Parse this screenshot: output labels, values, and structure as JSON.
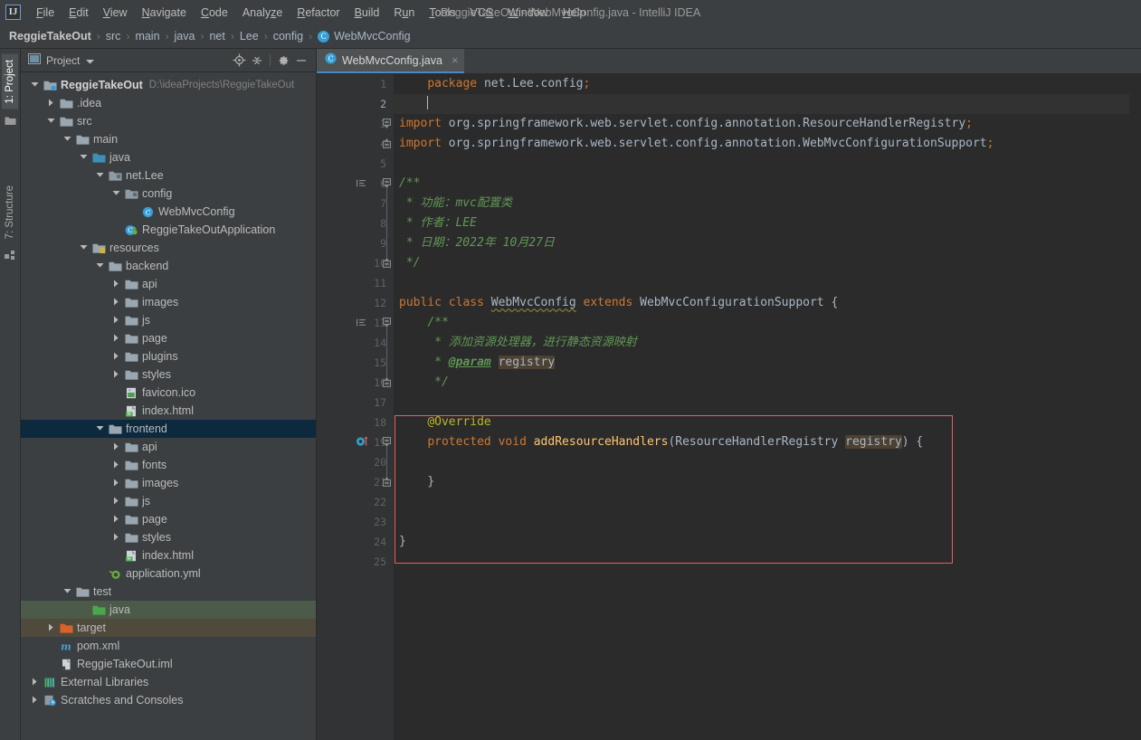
{
  "window": {
    "title": "ReggieTakeOut - WebMvcConfig.java - IntelliJ IDEA",
    "logo": "IJ"
  },
  "menubar": {
    "items": [
      {
        "label": "File",
        "mnemonic": "F"
      },
      {
        "label": "Edit",
        "mnemonic": "E"
      },
      {
        "label": "View",
        "mnemonic": "V"
      },
      {
        "label": "Navigate",
        "mnemonic": "N"
      },
      {
        "label": "Code",
        "mnemonic": "C"
      },
      {
        "label": "Analyze",
        "mnemonic": "z"
      },
      {
        "label": "Refactor",
        "mnemonic": "R"
      },
      {
        "label": "Build",
        "mnemonic": "B"
      },
      {
        "label": "Run",
        "mnemonic": "u"
      },
      {
        "label": "Tools",
        "mnemonic": "T"
      },
      {
        "label": "VCS",
        "mnemonic": "S"
      },
      {
        "label": "Window",
        "mnemonic": "W"
      },
      {
        "label": "Help",
        "mnemonic": "H"
      }
    ]
  },
  "breadcrumb": {
    "items": [
      "ReggieTakeOut",
      "src",
      "main",
      "java",
      "net",
      "Lee",
      "config"
    ],
    "leaf": "WebMvcConfig",
    "leaf_icon": "class-icon"
  },
  "toolstrip": {
    "tabs": [
      {
        "label": "1: Project",
        "active": true
      },
      {
        "label": "7: Structure",
        "active": false
      }
    ]
  },
  "project_panel": {
    "title": "Project",
    "buttons": [
      "locate-icon",
      "collapse-all-icon",
      "settings-icon",
      "hide-icon"
    ],
    "tree": [
      {
        "indent": 0,
        "twisty": "down",
        "icon": "module-folder",
        "label": "ReggieTakeOut",
        "bold": true,
        "path": "D:\\ideaProjects\\ReggieTakeOut"
      },
      {
        "indent": 1,
        "twisty": "right",
        "icon": "folder",
        "label": ".idea"
      },
      {
        "indent": 1,
        "twisty": "down",
        "icon": "folder",
        "label": "src"
      },
      {
        "indent": 2,
        "twisty": "down",
        "icon": "folder",
        "label": "main"
      },
      {
        "indent": 3,
        "twisty": "down",
        "icon": "source-folder",
        "label": "java"
      },
      {
        "indent": 4,
        "twisty": "down",
        "icon": "package",
        "label": "net.Lee"
      },
      {
        "indent": 5,
        "twisty": "down",
        "icon": "package",
        "label": "config"
      },
      {
        "indent": 6,
        "twisty": "none",
        "icon": "class-icon",
        "label": "WebMvcConfig"
      },
      {
        "indent": 5,
        "twisty": "none",
        "icon": "spring-class",
        "label": "ReggieTakeOutApplication"
      },
      {
        "indent": 3,
        "twisty": "down",
        "icon": "resource-folder",
        "label": "resources"
      },
      {
        "indent": 4,
        "twisty": "down",
        "icon": "folder",
        "label": "backend"
      },
      {
        "indent": 5,
        "twisty": "right",
        "icon": "folder",
        "label": "api"
      },
      {
        "indent": 5,
        "twisty": "right",
        "icon": "folder",
        "label": "images"
      },
      {
        "indent": 5,
        "twisty": "right",
        "icon": "folder",
        "label": "js"
      },
      {
        "indent": 5,
        "twisty": "right",
        "icon": "folder",
        "label": "page"
      },
      {
        "indent": 5,
        "twisty": "right",
        "icon": "folder",
        "label": "plugins"
      },
      {
        "indent": 5,
        "twisty": "right",
        "icon": "folder",
        "label": "styles"
      },
      {
        "indent": 5,
        "twisty": "none",
        "icon": "image-file",
        "label": "favicon.ico"
      },
      {
        "indent": 5,
        "twisty": "none",
        "icon": "html-file",
        "label": "index.html"
      },
      {
        "indent": 4,
        "twisty": "down",
        "icon": "folder",
        "label": "frontend",
        "selected": "blue"
      },
      {
        "indent": 5,
        "twisty": "right",
        "icon": "folder",
        "label": "api"
      },
      {
        "indent": 5,
        "twisty": "right",
        "icon": "folder",
        "label": "fonts"
      },
      {
        "indent": 5,
        "twisty": "right",
        "icon": "folder",
        "label": "images"
      },
      {
        "indent": 5,
        "twisty": "right",
        "icon": "folder",
        "label": "js"
      },
      {
        "indent": 5,
        "twisty": "right",
        "icon": "folder",
        "label": "page"
      },
      {
        "indent": 5,
        "twisty": "right",
        "icon": "folder",
        "label": "styles"
      },
      {
        "indent": 5,
        "twisty": "none",
        "icon": "html-file",
        "label": "index.html"
      },
      {
        "indent": 4,
        "twisty": "none",
        "icon": "yml-file",
        "label": "application.yml"
      },
      {
        "indent": 2,
        "twisty": "down",
        "icon": "folder",
        "label": "test"
      },
      {
        "indent": 3,
        "twisty": "none",
        "icon": "test-folder",
        "label": "java",
        "selected": "green"
      },
      {
        "indent": 1,
        "twisty": "right",
        "icon": "excluded-folder",
        "label": "target",
        "selected": "brown"
      },
      {
        "indent": 1,
        "twisty": "none",
        "icon": "maven-file",
        "label": "pom.xml"
      },
      {
        "indent": 1,
        "twisty": "none",
        "icon": "iml-file",
        "label": "ReggieTakeOut.iml"
      },
      {
        "indent": 0,
        "twisty": "right",
        "icon": "libraries-icon",
        "label": "External Libraries"
      },
      {
        "indent": 0,
        "twisty": "right",
        "icon": "scratches-icon",
        "label": "Scratches and Consoles"
      }
    ]
  },
  "editor": {
    "tab": {
      "label": "WebMvcConfig.java",
      "icon": "class-icon",
      "close": "×"
    },
    "current_line": 2,
    "total_lines": 25,
    "highlight_box": {
      "color": "#f05b5b",
      "from_line": 18,
      "to_line": 24
    },
    "gutter_markers": [
      {
        "line": 19,
        "icon": "override-method-icon"
      },
      {
        "line": 6,
        "icon": "doc-comment-icon"
      },
      {
        "line": 13,
        "icon": "doc-comment-icon"
      }
    ],
    "lines": [
      {
        "n": 1,
        "text": "    package net.Lee.config;"
      },
      {
        "n": 2,
        "text": "    "
      },
      {
        "n": 3,
        "text": "import org.springframework.web.servlet.config.annotation.ResourceHandlerRegistry;"
      },
      {
        "n": 4,
        "text": "import org.springframework.web.servlet.config.annotation.WebMvcConfigurationSupport;"
      },
      {
        "n": 5,
        "text": ""
      },
      {
        "n": 6,
        "text": "/**"
      },
      {
        "n": 7,
        "text": " * 功能：mvc配置类"
      },
      {
        "n": 8,
        "text": " * 作者：LEE"
      },
      {
        "n": 9,
        "text": " * 日期：2022年 10月27日"
      },
      {
        "n": 10,
        "text": " */"
      },
      {
        "n": 11,
        "text": ""
      },
      {
        "n": 12,
        "text": "public class WebMvcConfig extends WebMvcConfigurationSupport {"
      },
      {
        "n": 13,
        "text": "    /**"
      },
      {
        "n": 14,
        "text": "     * 添加资源处理器，进行静态资源映射"
      },
      {
        "n": 15,
        "text": "     * @param registry"
      },
      {
        "n": 16,
        "text": "     */"
      },
      {
        "n": 17,
        "text": ""
      },
      {
        "n": 18,
        "text": "    @Override"
      },
      {
        "n": 19,
        "text": "    protected void addResourceHandlers(ResourceHandlerRegistry registry) {"
      },
      {
        "n": 20,
        "text": ""
      },
      {
        "n": 21,
        "text": "    }"
      },
      {
        "n": 22,
        "text": ""
      },
      {
        "n": 23,
        "text": ""
      },
      {
        "n": 24,
        "text": "}"
      },
      {
        "n": 25,
        "text": ""
      }
    ],
    "tokens": {
      "package_kw": "package",
      "package_name": "net.Lee.config",
      "import_kw": "import",
      "import1": "org.springframework.web.servlet.config.annotation.ResourceHandlerRegistry",
      "import2": "org.springframework.web.servlet.config.annotation.WebMvcConfigurationSupport",
      "doc_open": "/**",
      "doc_close": "*/",
      "doc1_line1": "* 功能：mvc配置类",
      "doc1_line2": "* 作者：LEE",
      "doc1_line3": "* 日期：2022年 10月27日",
      "public_kw": "public",
      "class_kw": "class",
      "class_name": "WebMvcConfig",
      "extends_kw": "extends",
      "super_class": "WebMvcConfigurationSupport",
      "doc2_line1": "* 添加资源处理器，进行静态资源映射",
      "doc2_param_tag": "@param",
      "doc2_param_name": "registry",
      "override_anno": "@Override",
      "protected_kw": "protected",
      "void_kw": "void",
      "method_name": "addResourceHandlers",
      "param_type": "ResourceHandlerRegistry",
      "param_name": "registry",
      "brace_open": "{",
      "brace_close": "}",
      "semicolon": ";",
      "star": "*"
    }
  },
  "colors": {
    "keyword": "#cc7832",
    "comment": "#629755",
    "annotation": "#bbb529",
    "method": "#ffc66d",
    "text": "#a9b7c6",
    "editor_bg": "#2b2b2b",
    "panel_bg": "#3c3f41",
    "selection_blue": "#0d293e",
    "selection_green": "#4c5a49",
    "selection_brown": "#504a3c",
    "highlight_red": "#f05b5b",
    "accent": "#4a88c7"
  }
}
